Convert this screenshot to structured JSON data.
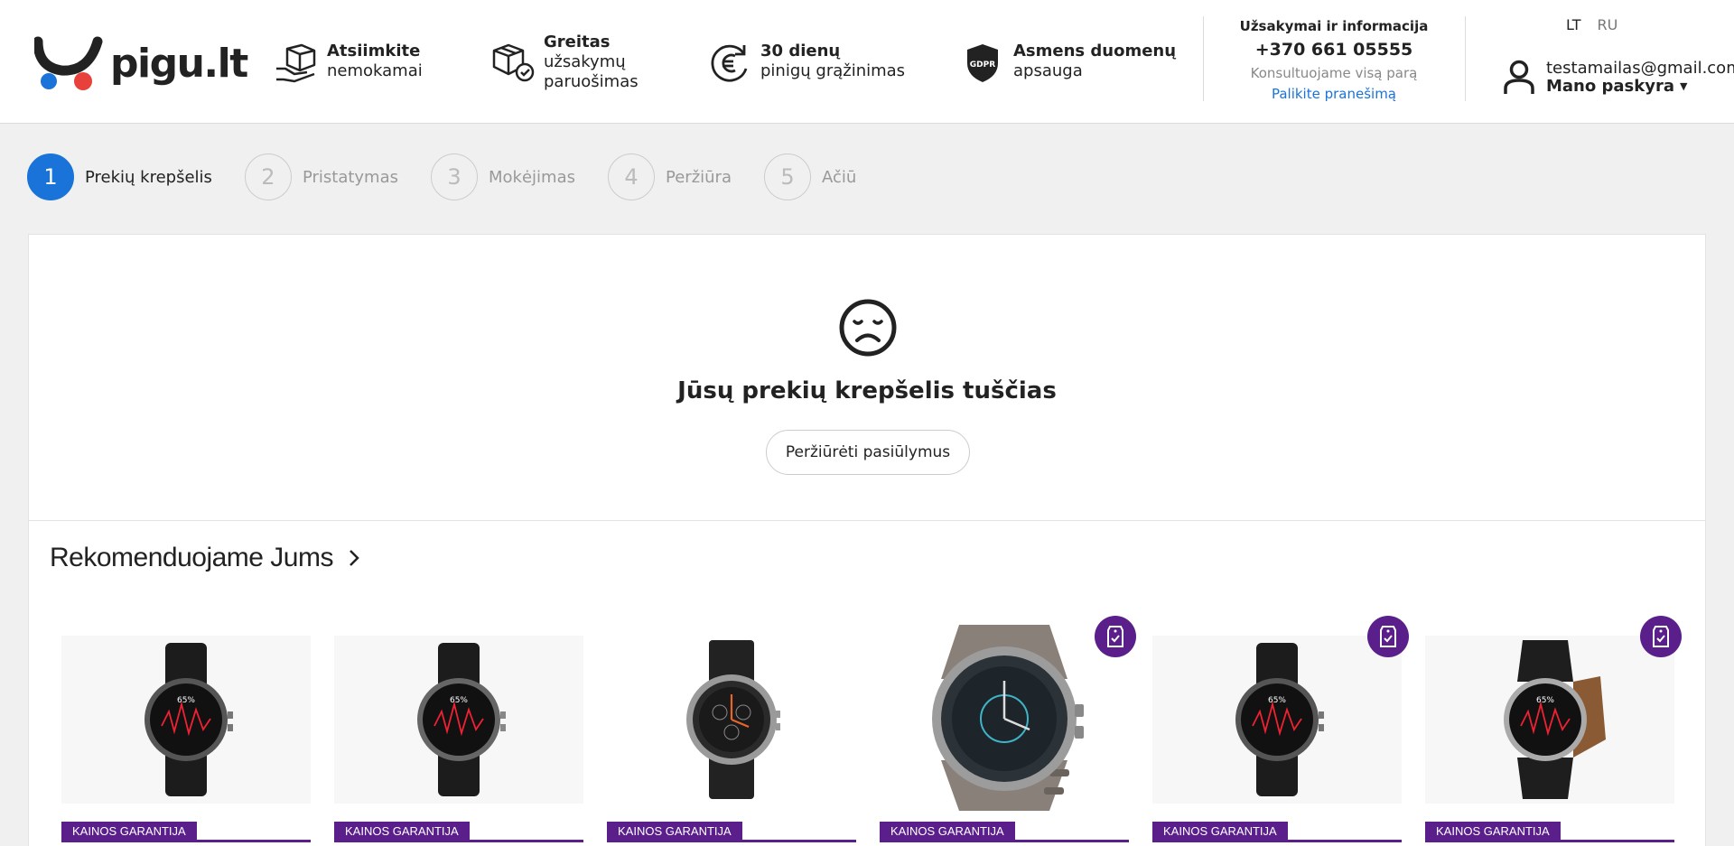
{
  "header": {
    "logo_text": "pigu.lt",
    "benefits": [
      {
        "title": "Atsiimkite",
        "sub": "nemokamai",
        "icon": "hand-box-icon"
      },
      {
        "title": "Greitas",
        "sub": "užsakymų",
        "sub2": "paruošimas",
        "icon": "package-check-icon"
      },
      {
        "title": "30 dienų",
        "sub": "pinigų grąžinimas",
        "icon": "euro-return-icon"
      },
      {
        "title": "Asmens duomenų",
        "sub": "apsauga",
        "icon": "gdpr-shield-icon"
      }
    ],
    "contact": {
      "title": "Užsakymai ir informacija",
      "phone": "+370 661 05555",
      "note": "Konsultuojame visą parą",
      "link": "Palikite pranešimą"
    },
    "languages": {
      "active": "LT",
      "other": "RU"
    },
    "account": {
      "email": "testamailas@gmail.com",
      "label": "Mano paskyra"
    }
  },
  "steps": [
    {
      "num": "1",
      "label": "Prekių krepšelis",
      "active": true
    },
    {
      "num": "2",
      "label": "Pristatymas",
      "active": false
    },
    {
      "num": "3",
      "label": "Mokėjimas",
      "active": false
    },
    {
      "num": "4",
      "label": "Peržiūra",
      "active": false
    },
    {
      "num": "5",
      "label": "Ačiū",
      "active": false
    }
  ],
  "cart": {
    "empty_title": "Jūsų prekių krepšelis tuščias",
    "browse_button": "Peržiūrėti pasiūlymus"
  },
  "recommendations": {
    "title": "Rekomenduojame Jums",
    "products": [
      {
        "badge": "KAINOS GARANTIJA",
        "guarantee_icon": false,
        "screen_text": "65%"
      },
      {
        "badge": "KAINOS GARANTIJA",
        "guarantee_icon": false,
        "screen_text": "65%"
      },
      {
        "badge": "KAINOS GARANTIJA",
        "guarantee_icon": false,
        "screen_text": ""
      },
      {
        "badge": "KAINOS GARANTIJA",
        "guarantee_icon": true,
        "screen_text": ""
      },
      {
        "badge": "KAINOS GARANTIJA",
        "guarantee_icon": true,
        "screen_text": "65%"
      },
      {
        "badge": "KAINOS GARANTIJA",
        "guarantee_icon": true,
        "screen_text": "65%"
      }
    ]
  },
  "colors": {
    "accent_blue": "#1a73d8",
    "badge_purple": "#5a1f8a",
    "logo_blue": "#1a73d8",
    "logo_red": "#e8403a"
  }
}
